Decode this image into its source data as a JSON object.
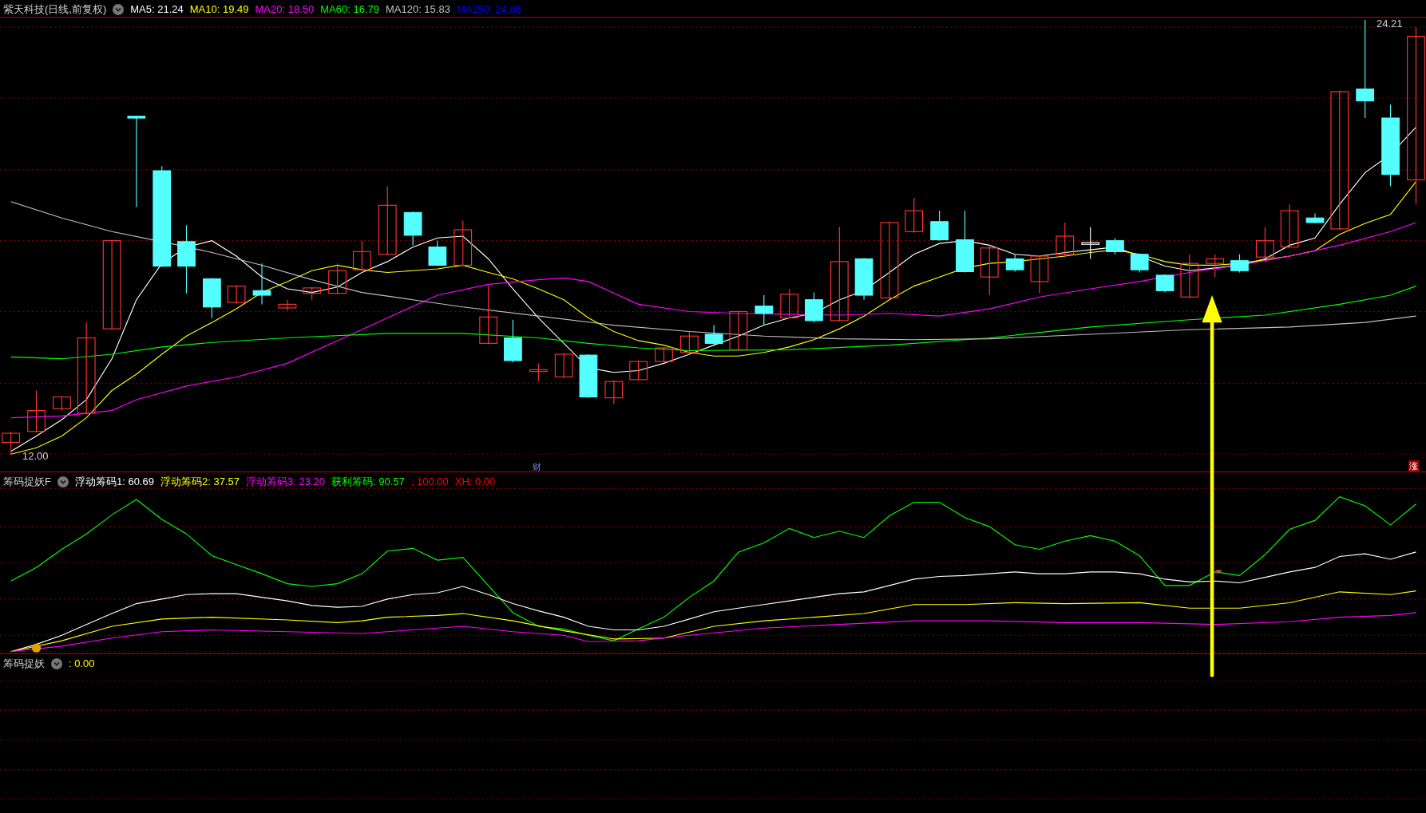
{
  "main_panel": {
    "title": "紫天科技(日线,前复权)",
    "indicators": [
      {
        "label": "MA5: 21.24",
        "color": "#ffffff"
      },
      {
        "label": "MA10: 19.49",
        "color": "#ffff00"
      },
      {
        "label": "MA20: 18.50",
        "color": "#ff00ff"
      },
      {
        "label": "MA60: 16.79",
        "color": "#00ff00"
      },
      {
        "label": "MA120: 15.83",
        "color": "#c0c0c0"
      },
      {
        "label": "MA250: 24.85",
        "color": "#0000ff"
      }
    ],
    "high_label": "24.21",
    "low_label": "12.00",
    "finance_marker": "财",
    "rise_marker": "涨"
  },
  "indicator_panel": {
    "title": "筹码捉妖F",
    "values": [
      {
        "label": "浮动筹码1: 60.69",
        "color": "#ffffff"
      },
      {
        "label": "浮动筹码2: 37.57",
        "color": "#ffff00"
      },
      {
        "label": "浮动筹码3: 23.20",
        "color": "#ff00ff"
      },
      {
        "label": "获利筹码: 90.57",
        "color": "#00ff00"
      },
      {
        "label": ": 100.00",
        "color": "#ff0000"
      },
      {
        "label": "XH: 0.00",
        "color": "#ff0000"
      }
    ]
  },
  "signal_panel": {
    "title": "筹码捉妖",
    "values": [
      {
        "label": ": 0.00",
        "color": "#ffff00"
      }
    ]
  }
}
